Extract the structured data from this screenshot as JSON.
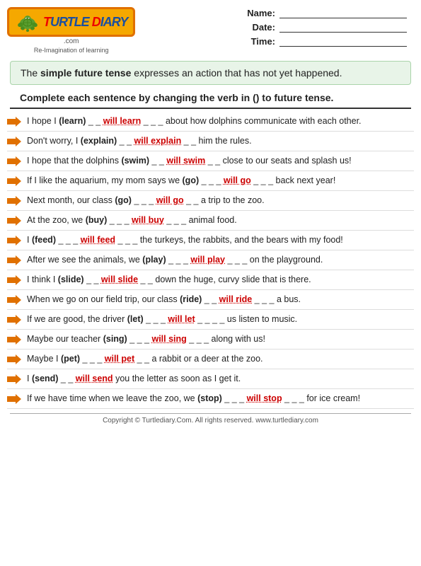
{
  "header": {
    "logo_main": "TURTLE DIARY",
    "logo_com": ".com",
    "logo_tagline": "Re-Imagination of learning",
    "name_label": "Name:",
    "date_label": "Date:",
    "time_label": "Time:"
  },
  "info_box": {
    "text_part1": "The ",
    "text_bold": "simple future tense",
    "text_part2": " expresses an action that has not yet happened."
  },
  "instructions": {
    "text": "Complete each sentence by changing the verb in () to future tense."
  },
  "sentences": [
    {
      "id": 1,
      "before": "I hope I ",
      "verb": "(learn)",
      "blanks_before": " _ _",
      "answer": "will learn",
      "blanks_after": "_ _ _",
      "after": " about how dolphins communicate with each other."
    },
    {
      "id": 2,
      "before": "Don't worry, I ",
      "verb": "(explain)",
      "blanks_before": " _ _",
      "answer": "will explain",
      "blanks_after": "_ _",
      "after": " him the rules."
    },
    {
      "id": 3,
      "before": "I hope that the dolphins ",
      "verb": "(swim)",
      "blanks_before": " _ _",
      "answer": "will swim",
      "blanks_after": "_ _",
      "after": " close to our seats and splash us!"
    },
    {
      "id": 4,
      "before": "If I like the aquarium, my mom says we ",
      "verb": "(go)",
      "blanks_before": " _ _ _",
      "answer": "will go",
      "blanks_after": "_ _ _",
      "after": " back next year!"
    },
    {
      "id": 5,
      "before": "Next month, our class ",
      "verb": "(go)",
      "blanks_before": " _ _ _",
      "answer": "will go",
      "blanks_after": "_ _",
      "after": " a trip to the zoo."
    },
    {
      "id": 6,
      "before": "At the zoo, we ",
      "verb": "(buy)",
      "blanks_before": " _ _ _",
      "answer": "will buy",
      "blanks_after": "_ _ _",
      "after": " animal food."
    },
    {
      "id": 7,
      "before": "I ",
      "verb": "(feed)",
      "blanks_before": " _ _ _",
      "answer": "will feed",
      "blanks_after": "_ _ _",
      "after": " the turkeys, the rabbits, and the bears with my food!"
    },
    {
      "id": 8,
      "before": "After we see the animals, we ",
      "verb": "(play)",
      "blanks_before": " _ _ _",
      "answer": "will play",
      "blanks_after": "_ _ _",
      "after": " on the playground."
    },
    {
      "id": 9,
      "before": "I think I ",
      "verb": "(slide)",
      "blanks_before": " _ _",
      "answer": "will slide",
      "blanks_after": "_ _",
      "after": " down the huge, curvy slide that is there."
    },
    {
      "id": 10,
      "before": "When we go on our field trip, our class ",
      "verb": "(ride)",
      "blanks_before": " _ _",
      "answer": "will ride",
      "blanks_after": "_ _ _",
      "after": " a bus."
    },
    {
      "id": 11,
      "before": "If we are good, the driver ",
      "verb": "(let)",
      "blanks_before": " _ _ _",
      "answer": "will let",
      "blanks_after": "_ _ _ _",
      "after": " us listen to music."
    },
    {
      "id": 12,
      "before": "Maybe our teacher ",
      "verb": "(sing)",
      "blanks_before": " _ _ _",
      "answer": "will sing",
      "blanks_after": "_ _ _",
      "after": " along with us!"
    },
    {
      "id": 13,
      "before": "Maybe I ",
      "verb": "(pet)",
      "blanks_before": " _ _ _",
      "answer": "will pet",
      "blanks_after": "_ _",
      "after": " a rabbit or a deer at the zoo."
    },
    {
      "id": 14,
      "before": "I ",
      "verb": "(send)",
      "blanks_before": " _ _",
      "answer": "will send",
      "blanks_after": "",
      "after": " you the letter as soon as I get it."
    },
    {
      "id": 15,
      "before": "If we have time when we leave the zoo, we ",
      "verb": "(stop)",
      "blanks_before": " _ _ _",
      "answer": "will stop",
      "blanks_after": "_ _ _",
      "after": " for ice cream!"
    }
  ],
  "footer": {
    "text": "Copyright © Turtlediary.Com. All rights reserved. www.turtlediary.com"
  }
}
